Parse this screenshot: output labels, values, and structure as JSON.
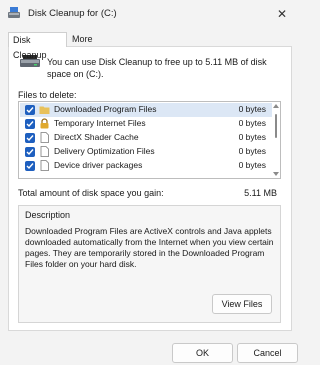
{
  "window": {
    "title": "Disk Cleanup for  (C:)",
    "close_glyph": "✕"
  },
  "tabs": [
    {
      "label": "Disk Cleanup",
      "active": true
    },
    {
      "label": "More Options",
      "active": false
    }
  ],
  "intro_text": "You can use Disk Cleanup to free up to 5.11 MB of disk space on  (C:).",
  "files_label": "Files to delete:",
  "files": [
    {
      "name": "Downloaded Program Files",
      "size": "0 bytes",
      "checked": true,
      "selected": true,
      "icon": "folder-icon"
    },
    {
      "name": "Temporary Internet Files",
      "size": "0 bytes",
      "checked": true,
      "selected": false,
      "icon": "lock-icon"
    },
    {
      "name": "DirectX Shader Cache",
      "size": "0 bytes",
      "checked": true,
      "selected": false,
      "icon": "file-icon"
    },
    {
      "name": "Delivery Optimization Files",
      "size": "0 bytes",
      "checked": true,
      "selected": false,
      "icon": "file-icon"
    },
    {
      "name": "Device driver packages",
      "size": "0 bytes",
      "checked": true,
      "selected": false,
      "icon": "file-icon"
    }
  ],
  "total": {
    "label": "Total amount of disk space you gain:",
    "value": "5.11 MB"
  },
  "description": {
    "title": "Description",
    "text": "Downloaded Program Files are ActiveX controls and Java applets downloaded automatically from the Internet when you view certain pages. They are temporarily stored in the Downloaded Program Files folder on your hard disk.",
    "view_files_label": "View Files"
  },
  "buttons": {
    "ok": "OK",
    "cancel": "Cancel"
  },
  "colors": {
    "accent": "#1e5fbf",
    "selection": "#dce7f5"
  }
}
